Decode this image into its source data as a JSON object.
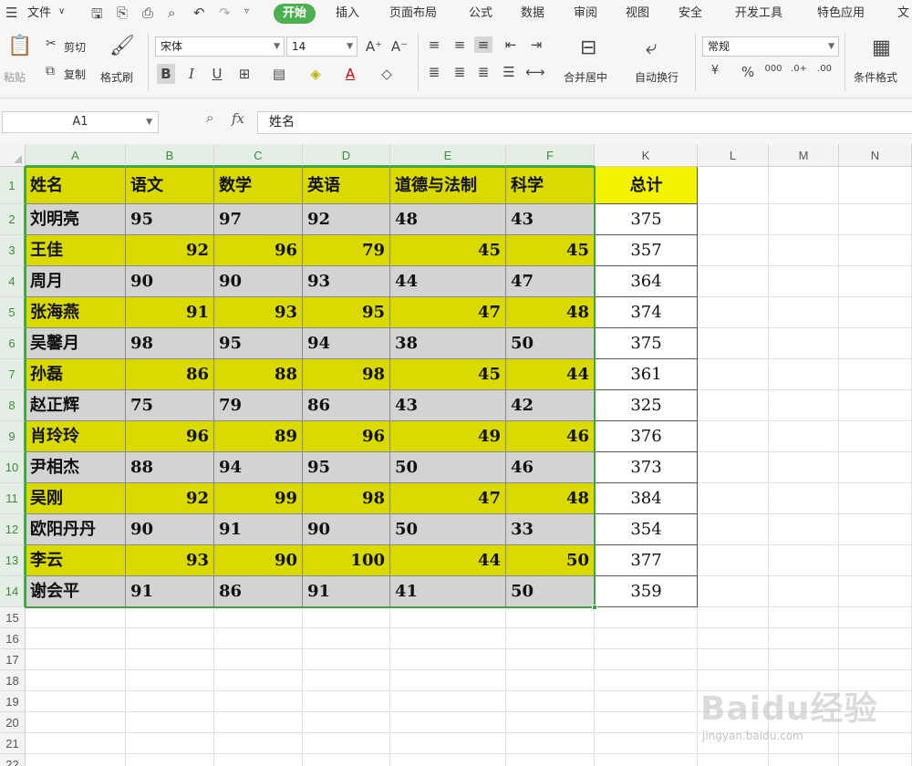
{
  "menubar": {
    "items": [
      "文件",
      "开始",
      "插入",
      "页面布局",
      "公式",
      "数据",
      "审阅",
      "视图",
      "安全",
      "开发工具",
      "特色应用",
      "文"
    ],
    "active": "开始"
  },
  "ribbon": {
    "paste": "粘贴",
    "cut": "剪切",
    "copy": "复制",
    "format_painter": "格式刷",
    "font_name": "宋体",
    "font_size": "14",
    "bold": "B",
    "italic": "I",
    "underline": "U",
    "merge_center": "合并居中",
    "wrap_text": "自动换行",
    "number_format": "常规",
    "conditional_format": "条件格式"
  },
  "formula_bar": {
    "cell_ref": "A1",
    "fx": "fx",
    "content": "姓名"
  },
  "sheet": {
    "columns": [
      "A",
      "B",
      "C",
      "D",
      "E",
      "F",
      "K",
      "L",
      "M",
      "N"
    ],
    "row_numbers": [
      "1",
      "2",
      "3",
      "4",
      "5",
      "6",
      "7",
      "8",
      "9",
      "10",
      "11",
      "12",
      "13",
      "14",
      "15",
      "16",
      "17",
      "18",
      "19",
      "20",
      "21",
      "22"
    ],
    "headers": [
      "姓名",
      "语文",
      "数学",
      "英语",
      "道德与法制",
      "科学"
    ],
    "total_header": "总计",
    "rows": [
      {
        "name": "刘明亮",
        "scores": [
          "95",
          "97",
          "92",
          "48",
          "43"
        ],
        "total": "375"
      },
      {
        "name": "王佳",
        "scores": [
          "92",
          "96",
          "79",
          "45",
          "45"
        ],
        "total": "357"
      },
      {
        "name": "周月",
        "scores": [
          "90",
          "90",
          "93",
          "44",
          "47"
        ],
        "total": "364"
      },
      {
        "name": "张海燕",
        "scores": [
          "91",
          "93",
          "95",
          "47",
          "48"
        ],
        "total": "374"
      },
      {
        "name": "吴馨月",
        "scores": [
          "98",
          "95",
          "94",
          "38",
          "50"
        ],
        "total": "375"
      },
      {
        "name": "孙磊",
        "scores": [
          "86",
          "88",
          "98",
          "45",
          "44"
        ],
        "total": "361"
      },
      {
        "name": "赵正辉",
        "scores": [
          "75",
          "79",
          "86",
          "43",
          "42"
        ],
        "total": "325"
      },
      {
        "name": "肖玲玲",
        "scores": [
          "96",
          "89",
          "96",
          "49",
          "46"
        ],
        "total": "376"
      },
      {
        "name": "尹相杰",
        "scores": [
          "88",
          "94",
          "95",
          "50",
          "46"
        ],
        "total": "373"
      },
      {
        "name": "吴刚",
        "scores": [
          "92",
          "99",
          "98",
          "47",
          "48"
        ],
        "total": "384"
      },
      {
        "name": "欧阳丹丹",
        "scores": [
          "90",
          "91",
          "90",
          "50",
          "33"
        ],
        "total": "354"
      },
      {
        "name": "李云",
        "scores": [
          "93",
          "90",
          "100",
          "44",
          "50"
        ],
        "total": "377"
      },
      {
        "name": "谢会平",
        "scores": [
          "91",
          "86",
          "91",
          "41",
          "50"
        ],
        "total": "359"
      }
    ]
  },
  "colors": {
    "band_yellow": "#dada00",
    "band_gray": "#d3d3d3",
    "total_header": "#f3f300",
    "selection": "#3da53d",
    "active_tab": "#4caf50"
  },
  "watermark": {
    "logo": "Baidu经验",
    "url": "jingyan.baidu.com"
  }
}
